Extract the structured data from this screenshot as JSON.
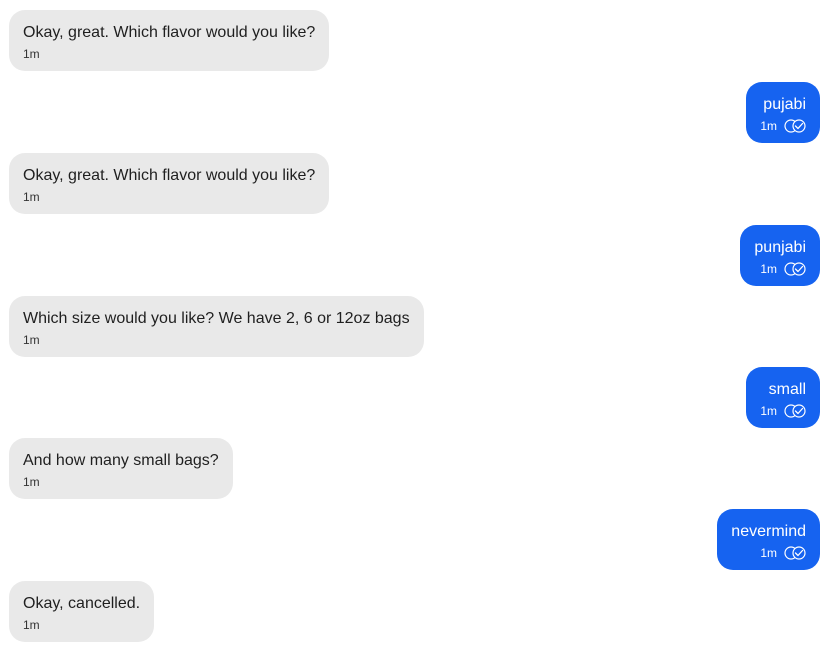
{
  "conversation": {
    "messages": [
      {
        "sender": "bot",
        "text": "Okay, great. Which flavor would you like?",
        "time": "1m"
      },
      {
        "sender": "user",
        "text": "pujabi",
        "time": "1m",
        "status": "read"
      },
      {
        "sender": "bot",
        "text": "Okay, great. Which flavor would you like?",
        "time": "1m"
      },
      {
        "sender": "user",
        "text": "punjabi",
        "time": "1m",
        "status": "read"
      },
      {
        "sender": "bot",
        "text": "Which size would you like? We have 2, 6 or 12oz bags",
        "time": "1m"
      },
      {
        "sender": "user",
        "text": "small",
        "time": "1m",
        "status": "read"
      },
      {
        "sender": "bot",
        "text": "And how many small bags?",
        "time": "1m"
      },
      {
        "sender": "user",
        "text": "nevermind",
        "time": "1m",
        "status": "read"
      },
      {
        "sender": "bot",
        "text": "Okay, cancelled.",
        "time": "1m"
      }
    ]
  },
  "colors": {
    "user_bubble": "#1663f0",
    "bot_bubble": "#e9e9e9"
  },
  "icons": {
    "read_receipt": "double-check-icon"
  }
}
